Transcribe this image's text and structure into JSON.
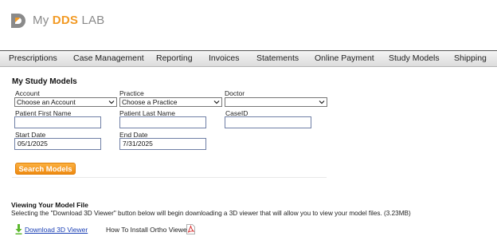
{
  "brand": {
    "my": "My",
    "dds": "DDS",
    "lab": "LAB",
    "accent": "#f29a24",
    "gray": "#8a8a8a"
  },
  "nav": {
    "items": [
      {
        "label": "Prescriptions"
      },
      {
        "label": "Case Management"
      },
      {
        "label": "Reporting"
      },
      {
        "label": "Invoices"
      },
      {
        "label": "Statements"
      },
      {
        "label": "Online Payment"
      },
      {
        "label": "Study Models"
      },
      {
        "label": "Shipping"
      }
    ]
  },
  "form": {
    "title": "My Study Models",
    "account": {
      "label": "Account",
      "value": "Choose an Account"
    },
    "practice": {
      "label": "Practice",
      "value": "Choose a Practice"
    },
    "doctor": {
      "label": "Doctor",
      "value": ""
    },
    "patient_first": {
      "label": "Patient First Name",
      "value": ""
    },
    "patient_last": {
      "label": "Patient Last Name",
      "value": ""
    },
    "case_id": {
      "label": "CaseID",
      "value": ""
    },
    "start_date": {
      "label": "Start Date",
      "value": "05/1/2025"
    },
    "end_date": {
      "label": "End Date",
      "value": "7/31/2025"
    },
    "search_label": "Search Models"
  },
  "viewer": {
    "title": "Viewing Your Model File",
    "description": "Selecting the \"Download 3D Viewer\" button below will begin downloading a 3D viewer that will allow you to view your model files. (3.23MB)",
    "download_label": "Download 3D Viewer",
    "install_label": "How To Install Ortho Viewer"
  }
}
